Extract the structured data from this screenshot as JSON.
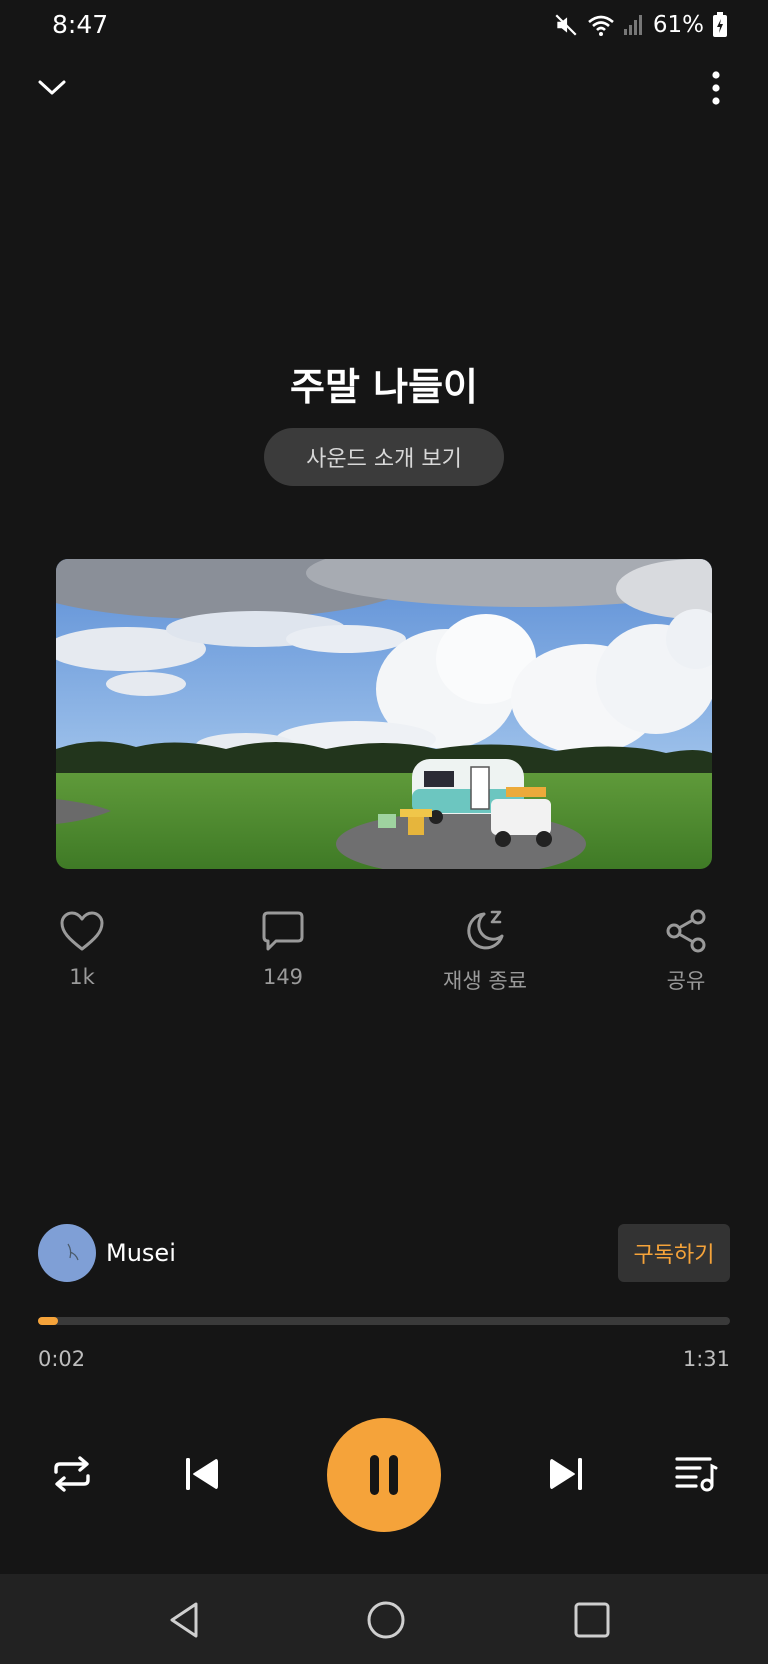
{
  "status_bar": {
    "time": "8:47",
    "battery": "61%"
  },
  "player": {
    "title": "주말 나들이",
    "intro_button": "사운드 소개 보기",
    "actions": [
      {
        "icon": "heart-icon",
        "label": "1k"
      },
      {
        "icon": "comment-icon",
        "label": "149"
      },
      {
        "icon": "sleep-timer-icon",
        "label": "재생 종료"
      },
      {
        "icon": "share-icon",
        "label": "공유"
      }
    ],
    "creator": {
      "name": "Musei",
      "subscribe_label": "구독하기"
    },
    "progress": {
      "current": "0:02",
      "total": "1:31",
      "fraction": 0.022
    },
    "state": "playing"
  },
  "colors": {
    "background": "#151515",
    "accent": "#f5a33a",
    "nav_bar": "#222222"
  }
}
